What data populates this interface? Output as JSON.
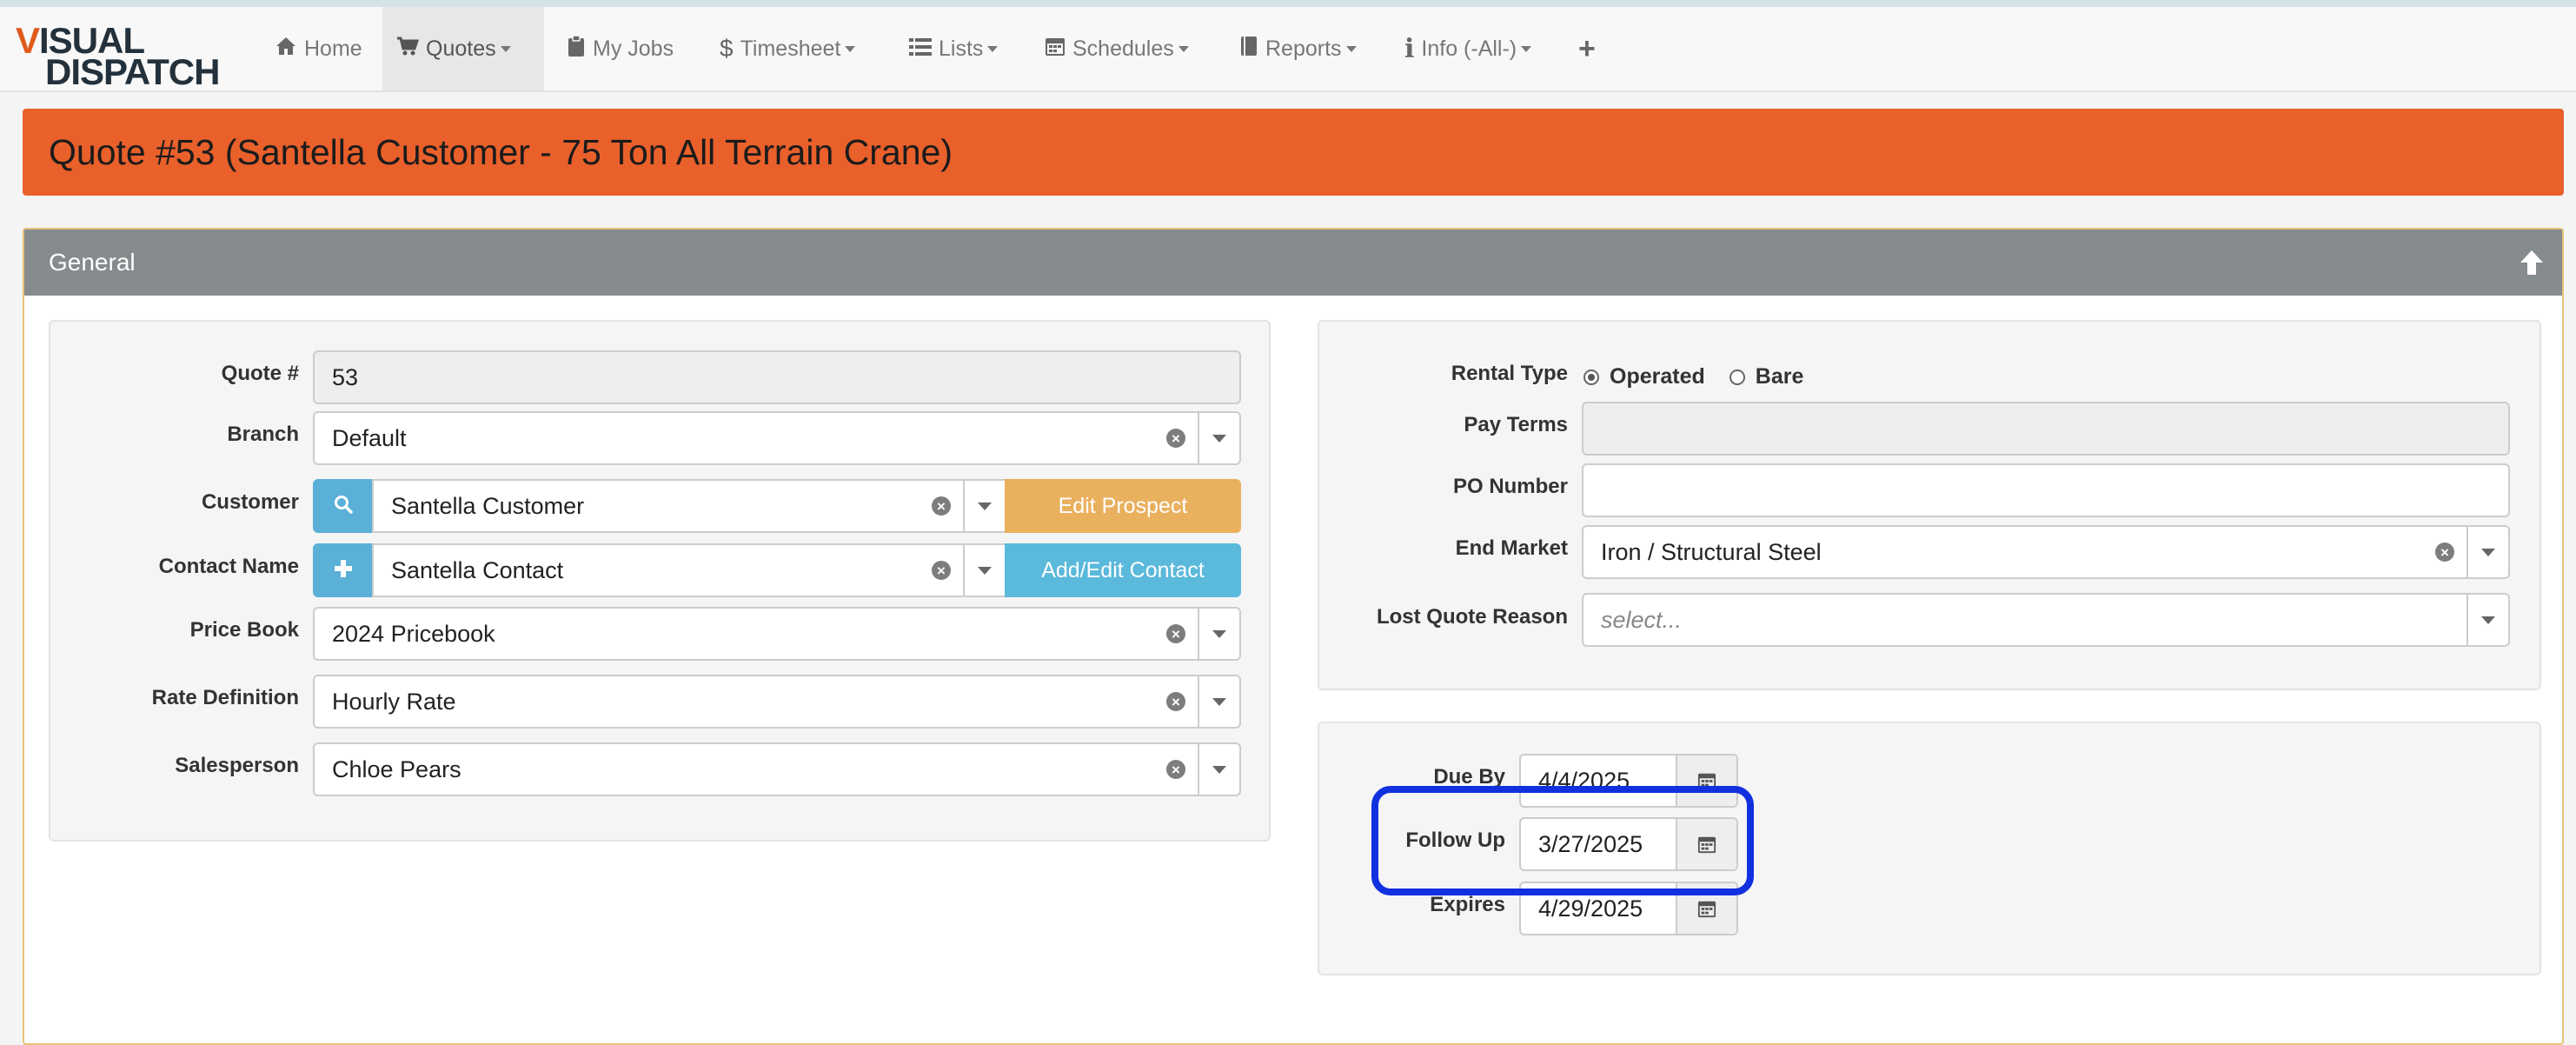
{
  "app": {
    "logo_line1_v": "V",
    "logo_line1_rest": "ISUAL",
    "logo_line2": "DISPATCH"
  },
  "nav": {
    "items": [
      {
        "label": "Home",
        "icon": "home-icon"
      },
      {
        "label": "Quotes",
        "icon": "cart-icon"
      },
      {
        "label": "My Jobs",
        "icon": "clipboard-icon"
      },
      {
        "label": "Timesheet",
        "icon": "dollar-icon"
      },
      {
        "label": "Lists",
        "icon": "list-icon"
      },
      {
        "label": "Schedules",
        "icon": "calendar-icon"
      },
      {
        "label": "Reports",
        "icon": "book-icon"
      },
      {
        "label": "Info (-All-)",
        "icon": "info-icon"
      }
    ],
    "add_icon": "plus-icon"
  },
  "page": {
    "title": "Quote #53 (Santella Customer - 75 Ton All Terrain Crane)",
    "section_title": "General"
  },
  "left": {
    "quote_label": "Quote #",
    "quote_value": "53",
    "branch_label": "Branch",
    "branch_value": "Default",
    "customer_label": "Customer",
    "customer_value": "Santella Customer",
    "edit_prospect": "Edit Prospect",
    "contact_label": "Contact Name",
    "contact_value": "Santella Contact",
    "add_edit_contact": "Add/Edit Contact",
    "pricebook_label": "Price Book",
    "pricebook_value": "2024 Pricebook",
    "rate_label": "Rate Definition",
    "rate_value": "Hourly Rate",
    "sales_label": "Salesperson",
    "sales_value": "Chloe Pears"
  },
  "right": {
    "rental_label": "Rental Type",
    "rental_operated": "Operated",
    "rental_bare": "Bare",
    "rental_selected": "Operated",
    "payterms_label": "Pay Terms",
    "payterms_value": "",
    "po_label": "PO Number",
    "po_value": "",
    "endmarket_label": "End Market",
    "endmarket_value": "Iron / Structural Steel",
    "lost_label": "Lost Quote Reason",
    "lost_placeholder": "select..."
  },
  "dates": {
    "due_label": "Due By",
    "due_value": "4/4/2025",
    "follow_label": "Follow Up",
    "follow_value": "3/27/2025",
    "expires_label": "Expires",
    "expires_value": "4/29/2025"
  },
  "colors": {
    "accent_title": "#e9602b",
    "panel_header": "#868b8d",
    "edit_prospect_btn": "#e9b05e",
    "contact_btn": "#5bb9db",
    "highlight": "#1130e0"
  }
}
